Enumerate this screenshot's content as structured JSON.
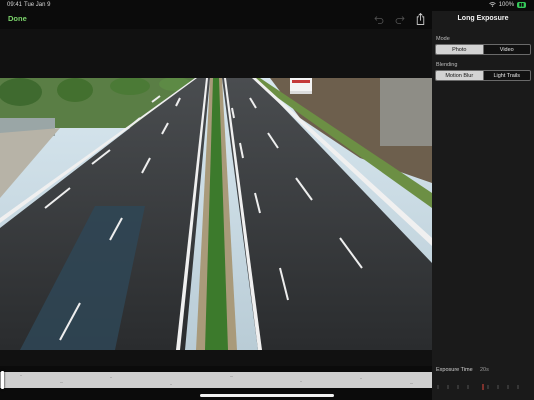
{
  "status": {
    "time": "09:41",
    "date": "Tue Jan 9",
    "battery": "100%"
  },
  "toolbar": {
    "done_label": "Done",
    "tools": [
      "undo-icon",
      "redo-icon",
      "share-icon"
    ]
  },
  "panel": {
    "title": "Long Exposure",
    "mode": {
      "label": "Mode",
      "options": [
        "Photo",
        "Video"
      ],
      "selected": "Photo"
    },
    "blending": {
      "label": "Blending",
      "options": [
        "Motion Blur",
        "Light Trails"
      ],
      "selected": "Motion Blur"
    },
    "exposure": {
      "label": "Exposure Time",
      "value": "20s"
    }
  },
  "colors": {
    "accent": "#7bd36b",
    "battery": "#34c759",
    "tick_marker": "#e0483d"
  }
}
